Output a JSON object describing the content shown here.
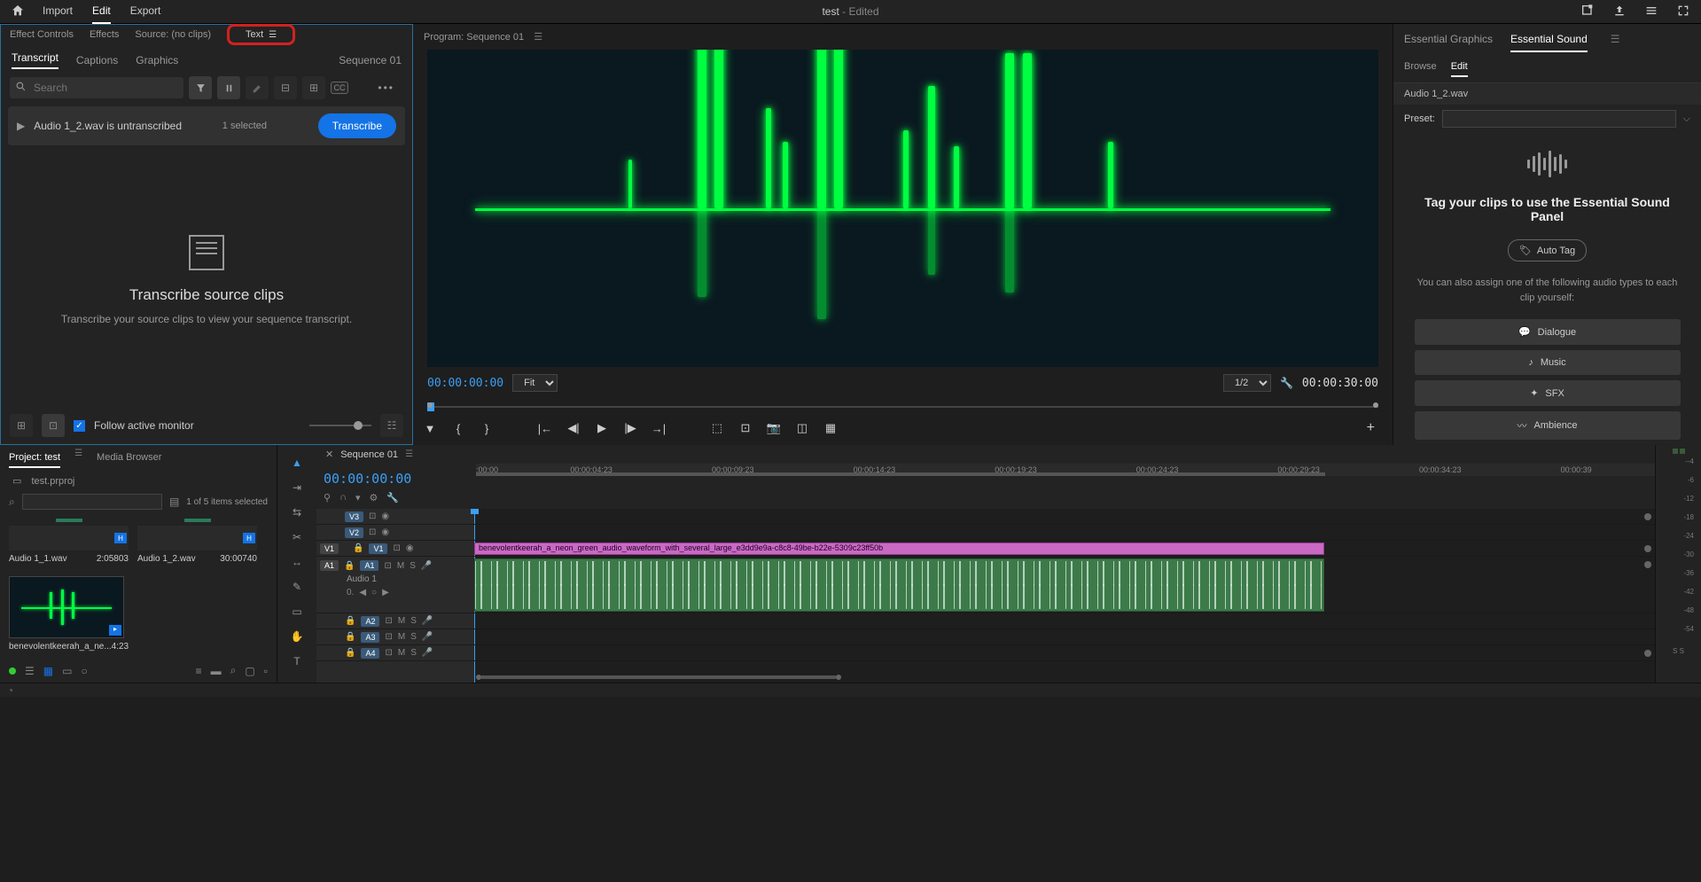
{
  "topbar": {
    "tabs": [
      "Import",
      "Edit",
      "Export"
    ],
    "active": "Edit",
    "title": "test",
    "title_suffix": " - Edited"
  },
  "left": {
    "panel_tabs": [
      "Effect Controls",
      "Effects",
      "Source: (no clips)",
      "Text"
    ],
    "sub_tabs": [
      "Transcript",
      "Captions",
      "Graphics"
    ],
    "sub_active": "Transcript",
    "sequence_label": "Sequence 01",
    "search_placeholder": "Search",
    "untranscribed_clip": "Audio 1_2.wav is untranscribed",
    "selected_text": "1 selected",
    "transcribe_btn": "Transcribe",
    "empty_title": "Transcribe source clips",
    "empty_sub": "Transcribe your source clips to view your sequence transcript.",
    "follow_monitor": "Follow active monitor"
  },
  "program": {
    "header": "Program: Sequence 01",
    "timecode_left": "00:00:00:00",
    "fit_label": "Fit",
    "zoom_label": "1/2",
    "timecode_right": "00:00:30:00"
  },
  "right": {
    "tabs": [
      "Essential Graphics",
      "Essential Sound"
    ],
    "active_tab": "Essential Sound",
    "subtabs": [
      "Browse",
      "Edit"
    ],
    "active_subtab": "Edit",
    "audio_name": "Audio 1_2.wav",
    "preset_label": "Preset:",
    "es_title": "Tag your clips to use the Essential Sound Panel",
    "auto_tag": "Auto Tag",
    "es_desc": "You can also assign one of the following audio types to each clip yourself:",
    "types": [
      "Dialogue",
      "Music",
      "SFX",
      "Ambience"
    ]
  },
  "project": {
    "tabs": [
      "Project: test",
      "Media Browser"
    ],
    "active": "Project: test",
    "project_file": "test.prproj",
    "items_text": "1 of 5 items selected",
    "items": [
      {
        "name": "Audio 1_1.wav",
        "dur": "2:05803"
      },
      {
        "name": "Audio 1_2.wav",
        "dur": "30:00740"
      }
    ],
    "large_item": {
      "name": "benevolentkeerah_a_ne...",
      "dur": "4:23"
    }
  },
  "timeline": {
    "sequence_name": "Sequence 01",
    "timecode": "00:00:00:00",
    "ruler_ticks": [
      ":00:00",
      "00:00:04:23",
      "00:00:09:23",
      "00:00:14:23",
      "00:00:19:23",
      "00:00:24:23",
      "00:00:29:23",
      "00:00:34:23",
      "00:00:39"
    ],
    "video_tracks": [
      "V3",
      "V2",
      "V1"
    ],
    "audio_tracks": [
      "A1",
      "A2",
      "A3",
      "A4"
    ],
    "audio_label": "Audio 1",
    "vol_label": "0.",
    "clip_video_name": "benevolentkeerah_a_neon_green_audio_waveform_with_several_large_e3dd9e9a-c8c8-49be-b22e-5309c23ff50b"
  },
  "meters": {
    "scale": [
      "--4",
      "-6",
      "-12",
      "-18",
      "-24",
      "-30",
      "-36",
      "-42",
      "-48",
      "-54",
      ""
    ],
    "lr": "S   S"
  }
}
